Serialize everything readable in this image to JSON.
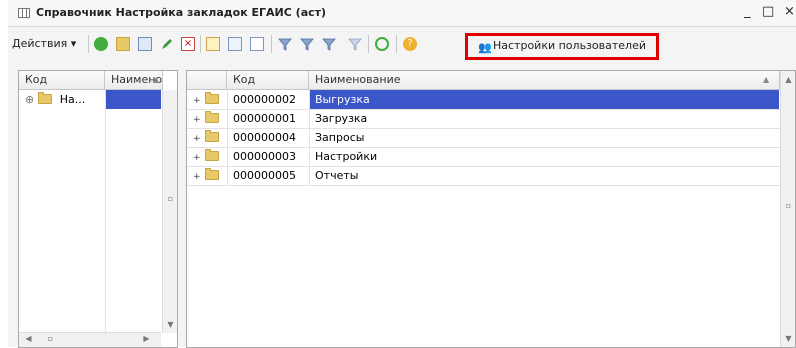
{
  "window": {
    "title": "Справочник Настройка закладок ЕГАИС (аст)",
    "minimize": "_",
    "maximize": "□",
    "close": "×"
  },
  "toolbar": {
    "actions_label": "Действия ▾",
    "user_settings_label": "Настройки пользователей"
  },
  "left_table": {
    "columns": [
      "Код",
      "Наименов"
    ],
    "rows": [
      {
        "label": "На..."
      }
    ]
  },
  "right_table": {
    "columns": [
      "Код",
      "Наименование"
    ],
    "rows": [
      {
        "code": "000000002",
        "name": "Выгрузка"
      },
      {
        "code": "000000001",
        "name": "Загрузка"
      },
      {
        "code": "000000004",
        "name": "Запросы"
      },
      {
        "code": "000000003",
        "name": "Настройки"
      },
      {
        "code": "000000005",
        "name": "Отчеты"
      }
    ],
    "selected_index": 0
  },
  "colors": {
    "selection": "#3a56c8",
    "highlight_box": "#e00000"
  }
}
